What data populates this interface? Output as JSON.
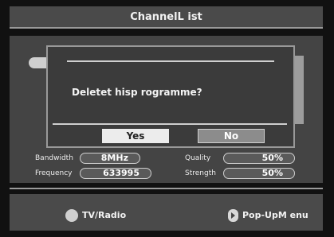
{
  "header": {
    "title": "ChannelL ist"
  },
  "dialog": {
    "message": "Deletet hisp rogramme?",
    "yes_label": "Yes",
    "no_label": "No",
    "selected": "Yes"
  },
  "signal_info": {
    "bandwidth_label": "Bandwidth",
    "bandwidth_value": "8MHz",
    "frequency_label": "Frequency",
    "frequency_value": "633995",
    "quality_label": "Quality",
    "quality_value": "50%",
    "strength_label": "Strength",
    "strength_value": "50%"
  },
  "footer": {
    "tv_radio_label": "TV/Radio",
    "tv_radio_icon": "circle-button-icon",
    "popup_label": "Pop-UpM enu",
    "popup_icon": "play-button-icon"
  },
  "colors": {
    "background": "#111111",
    "panel": "#444444",
    "selected_button": "#ececec",
    "unselected_button": "#8c8c8c"
  }
}
